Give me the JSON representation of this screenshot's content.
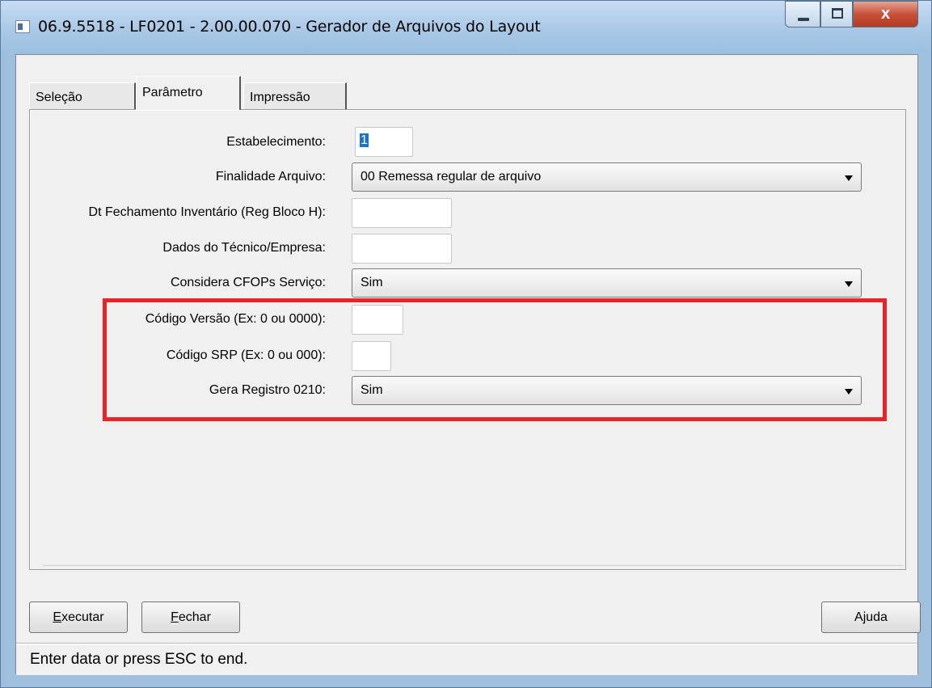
{
  "window": {
    "title": "06.9.5518 - LF0201 - 2.00.00.070 - Gerador de Arquivos do Layout",
    "controls": {
      "minimize": "minimize",
      "maximize": "maximize",
      "close": "x"
    }
  },
  "tabs": [
    {
      "label": "Seleção",
      "active": false
    },
    {
      "label": "Parâmetro",
      "active": true
    },
    {
      "label": "Impressão",
      "active": false
    }
  ],
  "form": {
    "estabelecimento": {
      "label": "Estabelecimento:",
      "value": "1"
    },
    "finalidade": {
      "label": "Finalidade Arquivo:",
      "value": "00 Remessa regular de arquivo"
    },
    "dt_fechamento": {
      "label": "Dt Fechamento Inventário (Reg Bloco H):",
      "value": ""
    },
    "dados_tecnico": {
      "label": "Dados do Técnico/Empresa:",
      "value": ""
    },
    "considera_cfops": {
      "label": "Considera CFOPs Serviço:",
      "value": "Sim"
    },
    "codigo_versao": {
      "label": "Código Versão (Ex: 0 ou 0000):",
      "value": ""
    },
    "codigo_srp": {
      "label": "Código SRP (Ex: 0 ou 000):",
      "value": ""
    },
    "gera_registro": {
      "label": "Gera Registro 0210:",
      "value": "Sim"
    }
  },
  "buttons": {
    "executar": {
      "underlined": "E",
      "rest": "xecutar"
    },
    "fechar": {
      "underlined": "F",
      "rest": "echar"
    },
    "ajuda": {
      "label": "Ajuda"
    }
  },
  "status": {
    "text": "Enter data or press ESC to end."
  },
  "colors": {
    "highlight": "#e8242b",
    "titlebar": "#a8c8e6",
    "close_button": "#c8513a",
    "selection": "#1e73c8"
  }
}
